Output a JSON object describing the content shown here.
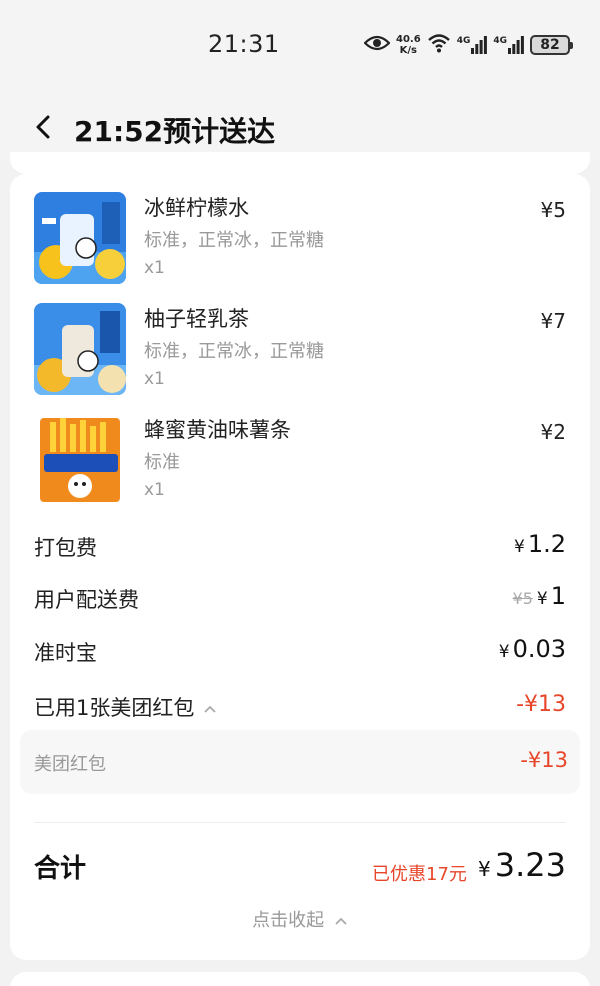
{
  "status_bar": {
    "time": "21:31",
    "net_speed_value": "40.6",
    "net_speed_unit": "K/s",
    "signal1_label": "4G",
    "signal2_label": "4G",
    "battery": "82"
  },
  "header": {
    "title": "21:52预计送达"
  },
  "items": [
    {
      "name": "冰鲜柠檬水",
      "spec": "标准，正常冰，正常糖",
      "qty": "x1",
      "price": "¥5"
    },
    {
      "name": "柚子轻乳茶",
      "spec": "标准，正常冰，正常糖",
      "qty": "x1",
      "price": "¥7"
    },
    {
      "name": "蜂蜜黄油味薯条",
      "spec": "标准",
      "qty": "x1",
      "price": "¥2"
    }
  ],
  "fees": {
    "packing_label": "打包费",
    "packing_value": "1.2",
    "delivery_label": "用户配送费",
    "delivery_original": "¥5",
    "delivery_value": "1",
    "ontime_label": "准时宝",
    "ontime_value": "0.03",
    "coupon_label": "已用1张美团红包",
    "coupon_value": "-¥13",
    "coupon_detail_label": "美团红包",
    "coupon_detail_value": "-¥13",
    "currency": "¥"
  },
  "total": {
    "label": "合计",
    "discount": "已优惠17元",
    "amount": "3.23"
  },
  "collapse_label": "点击收起",
  "colors": {
    "accent_red": "#e8462a",
    "muted": "#999999"
  }
}
